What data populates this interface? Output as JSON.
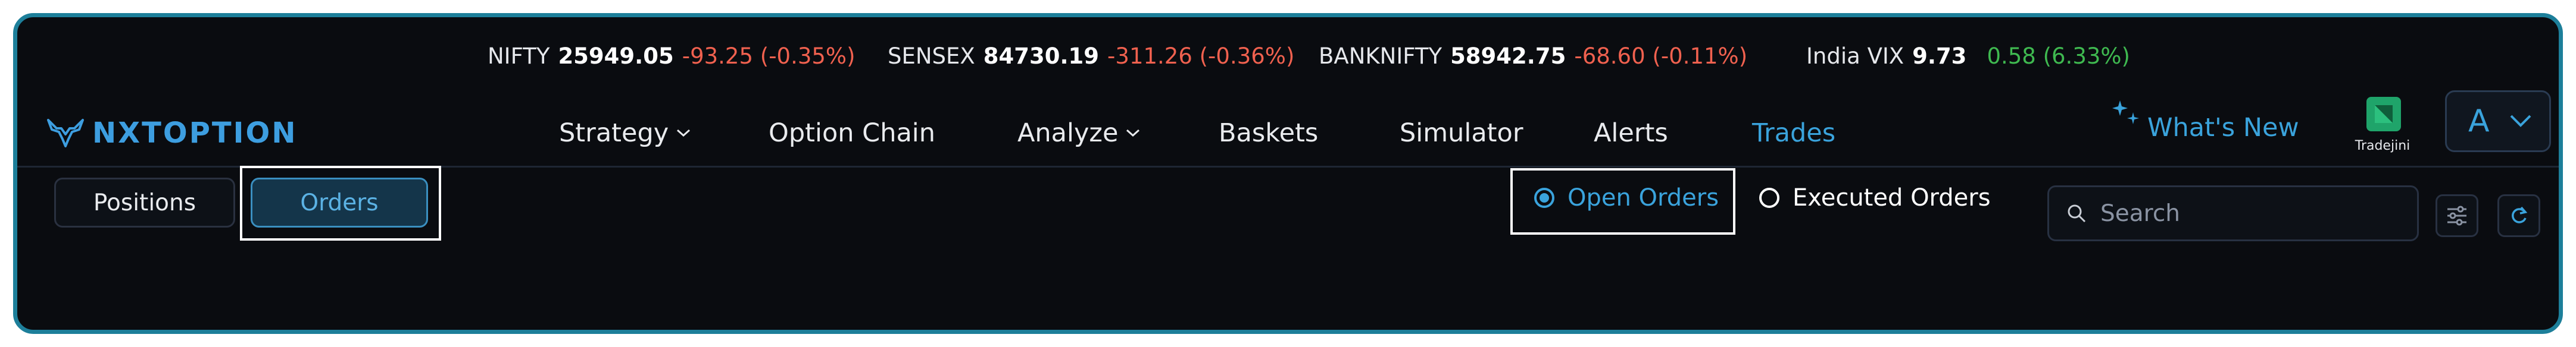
{
  "ticker": [
    {
      "name": "NIFTY",
      "value": "25949.05",
      "change": "-93.25 (-0.35%)",
      "direction": "down"
    },
    {
      "name": "SENSEX",
      "value": "84730.19",
      "change": "-311.26 (-0.36%)",
      "direction": "down"
    },
    {
      "name": "BANKNIFTY",
      "value": "58942.75",
      "change": "-68.60 (-0.11%)",
      "direction": "down"
    },
    {
      "name": "India VIX",
      "value": "9.73",
      "change": "0.58 (6.33%)",
      "direction": "up"
    }
  ],
  "brand": {
    "name": "NXTOPTION",
    "icon": "bull-logo-icon"
  },
  "nav": {
    "items": [
      {
        "label": "Strategy",
        "dropdown": true
      },
      {
        "label": "Option Chain",
        "dropdown": false
      },
      {
        "label": "Analyze",
        "dropdown": true
      },
      {
        "label": "Baskets",
        "dropdown": false
      },
      {
        "label": "Simulator",
        "dropdown": false
      },
      {
        "label": "Alerts",
        "dropdown": false
      },
      {
        "label": "Trades",
        "dropdown": false,
        "active": true
      }
    ],
    "whats_new": "What's New",
    "broker_label": "Tradejini",
    "account_initial": "A"
  },
  "view_toggle": {
    "positions_label": "Positions",
    "orders_label": "Orders",
    "selected": "Orders"
  },
  "order_filter": {
    "open_label": "Open Orders",
    "executed_label": "Executed Orders",
    "selected": "Open Orders"
  },
  "search": {
    "placeholder": "Search",
    "value": ""
  },
  "colors": {
    "accent": "#3aa3dc",
    "negative": "#f0614f",
    "positive": "#3fb950",
    "background": "#0a0c10",
    "frame_border": "#1d7f9a",
    "broker_green": "#1fa46a"
  }
}
